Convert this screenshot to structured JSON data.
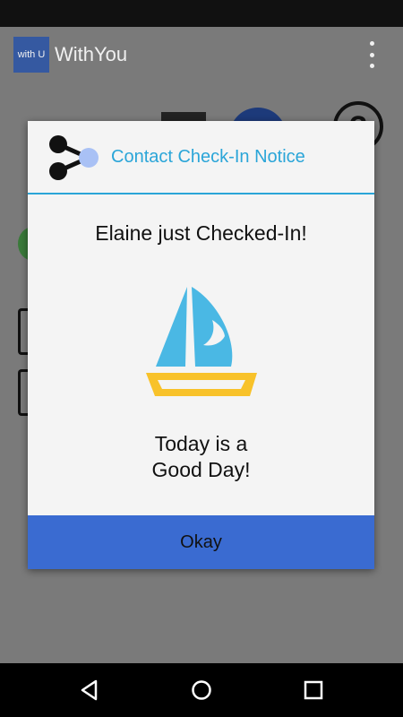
{
  "app_bar": {
    "logo_text": "with U",
    "title": "WithYou"
  },
  "dialog": {
    "title": "Contact Check-In Notice",
    "message": "Elaine just Checked-In!",
    "caption_line1": "Today is a",
    "caption_line2": "Good Day!",
    "okay_label": "Okay",
    "header_icon": "share-icon",
    "image_icon": "sailboat-icon"
  },
  "background": {
    "help_glyph": "?"
  },
  "nav": {
    "back_icon": "back-icon",
    "home_icon": "home-icon",
    "recents_icon": "recents-icon"
  },
  "colors": {
    "accent": "#2aa5d8",
    "button": "#3a6bd1",
    "sail": "#4ab8e4",
    "hull": "#f8c22a"
  }
}
